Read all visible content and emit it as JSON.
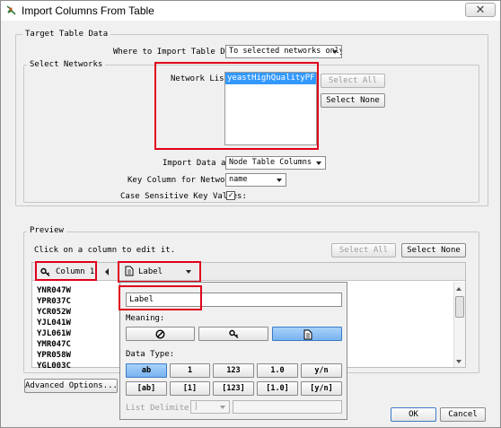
{
  "window": {
    "title": "Import Columns From Table",
    "close_glyph": "✕"
  },
  "target": {
    "group_label": "Target Table Data",
    "where_label": "Where to Import Table Data:",
    "where_value": "To selected networks only",
    "select_networks_label": "Select Networks",
    "network_list_label": "Network List:",
    "network_selected": "yeastHighQualityPF.txt",
    "select_all": "Select All",
    "select_none": "Select None",
    "import_as_label": "Import Data as:",
    "import_as_value": "Node Table Columns",
    "key_column_label": "Key Column for Networks:",
    "key_column_value": "name",
    "case_sensitive_label": "Case Sensitive Key Values:",
    "case_sensitive_mark": "✓"
  },
  "preview": {
    "group_label": "Preview",
    "hint": "Click on a column to edit it.",
    "select_all": "Select All",
    "select_none": "Select None",
    "column1_header": "Column 1",
    "label_header": "Label",
    "rows": [
      "YNR047W",
      "YPR037C",
      "YCR052W",
      "YJL041W",
      "YJL061W",
      "YMR047C",
      "YPR058W",
      "YGL003C"
    ]
  },
  "popup": {
    "name_value": "Label",
    "meaning_label": "Meaning:",
    "data_type_label": "Data Type:",
    "types_row1": [
      "ab",
      "1",
      "123",
      "1.0",
      "y/n"
    ],
    "types_row2": [
      "[ab]",
      "[1]",
      "[123]",
      "[1.0]",
      "[y/n]"
    ],
    "list_delimiter_label": "List Delimiter:",
    "list_delimiter_value": "|"
  },
  "footer": {
    "advanced": "Advanced Options...",
    "ok": "OK",
    "cancel": "Cancel"
  },
  "colors": {
    "highlight_red": "#e0001a",
    "selection_blue": "#3399ff",
    "toggle_on": "#78b2ef"
  }
}
